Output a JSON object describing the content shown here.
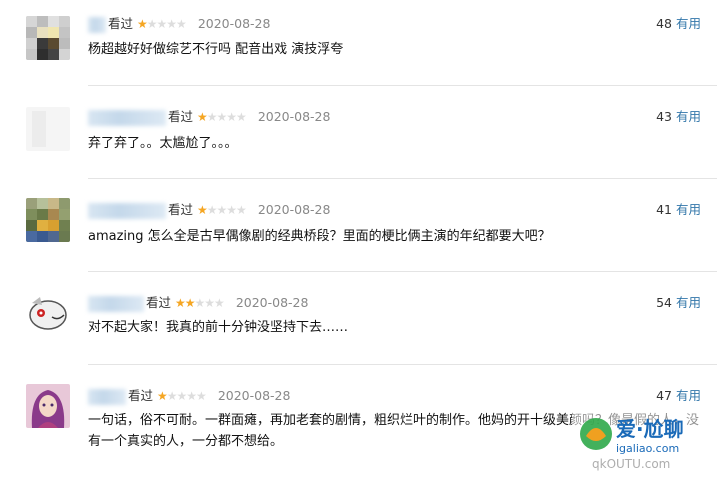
{
  "comments": [
    {
      "watched": "看过",
      "rating": 1,
      "date": "2020-08-28",
      "votes": "48",
      "useful_label": "有用",
      "text": "杨超越好好做综艺不行吗 配音出戏 演技浮夸",
      "avatar": "pixelated-avatar"
    },
    {
      "watched": "看过",
      "rating": 1,
      "date": "2020-08-28",
      "votes": "43",
      "useful_label": "有用",
      "text": "弃了弃了。。太尴尬了。。。",
      "avatar": "blank-avatar"
    },
    {
      "watched": "看过",
      "rating": 1,
      "date": "2020-08-28",
      "votes": "41",
      "useful_label": "有用",
      "text": "amazing 怎么全是古早偶像剧的经典桥段？里面的梗比俩主演的年纪都要大吧？",
      "avatar": "pixelated-avatar"
    },
    {
      "watched": "看过",
      "rating": 2,
      "date": "2020-08-28",
      "votes": "54",
      "useful_label": "有用",
      "text": "对不起大家！我真的前十分钟没坚持下去……",
      "avatar": "cartoon-avatar"
    },
    {
      "watched": "看过",
      "rating": 1,
      "date": "2020-08-28",
      "votes": "47",
      "useful_label": "有用",
      "text": "一句话，俗不可耐。一群面瘫，再加老套的剧情，粗织烂叶的制作。他妈的开十级美颜吗？像是假的人，没有一个真实的人，一分都不想给。",
      "avatar": "anime-avatar"
    }
  ],
  "watermark": {
    "big": "爱·尬聊",
    "small": "igaliao.com",
    "sub": "qkOUTU.com"
  },
  "colors": {
    "star": "#f5a623",
    "useful_link": "#3377aa",
    "divider": "#e4e4e4"
  }
}
